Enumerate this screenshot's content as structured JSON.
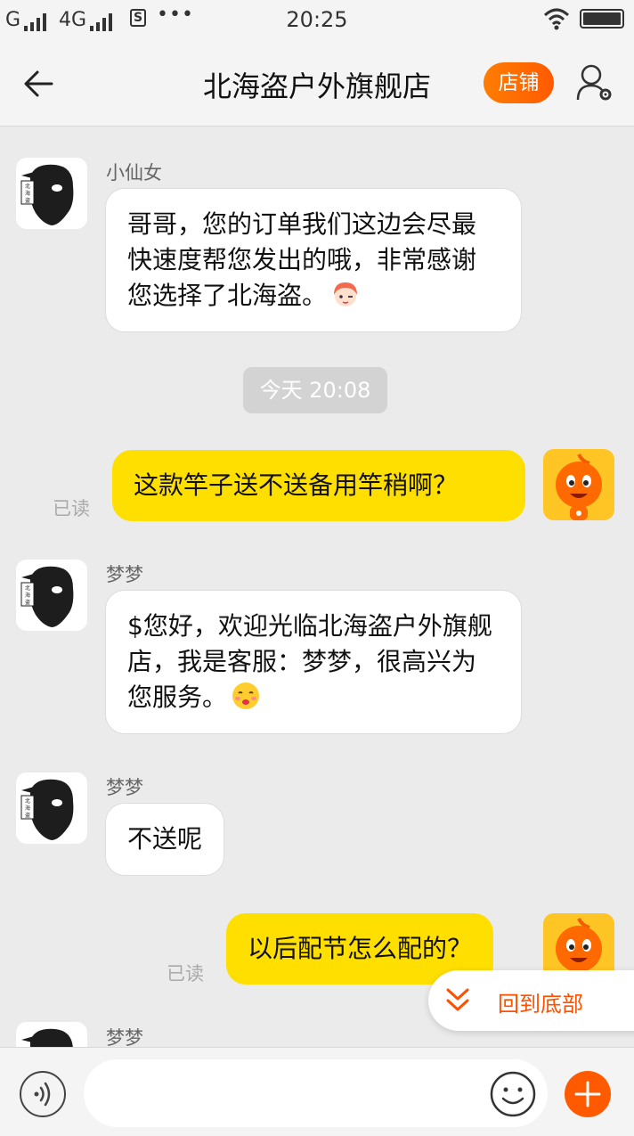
{
  "status_bar": {
    "carrier1": "G",
    "carrier2": "4G",
    "sim_badge": "S",
    "dots": "•••",
    "time": "20:25"
  },
  "header": {
    "title": "北海盗户外旗舰店",
    "shop_button": "店铺"
  },
  "messages": [
    {
      "sender": "小仙女",
      "text": "哥哥，您的订单我们这边会尽最快速度帮您发出的哦，非常感谢您选择了北海盗。",
      "emoji": "girl-wink-emoji"
    },
    {
      "timestamp": "今天  20:08"
    },
    {
      "text": "这款竿子送不送备用竿稍啊？",
      "read_label": "已读"
    },
    {
      "sender": "梦梦",
      "text": "$您好，欢迎光临北海盗户外旗舰店，我是客服：梦梦，很高兴为您服务。",
      "emoji": "kiss-emoji"
    },
    {
      "sender": "梦梦",
      "text": "不送呢"
    },
    {
      "text": "以后配节怎么配的？",
      "read_label": "已读"
    },
    {
      "sender": "梦梦"
    }
  ],
  "scroll_to_bottom": {
    "label": "回到底部"
  },
  "input_bar": {
    "placeholder": ""
  },
  "colors": {
    "accent": "#ff5000",
    "outgoing_bubble": "#ffdf00",
    "background": "#ebebeb"
  }
}
